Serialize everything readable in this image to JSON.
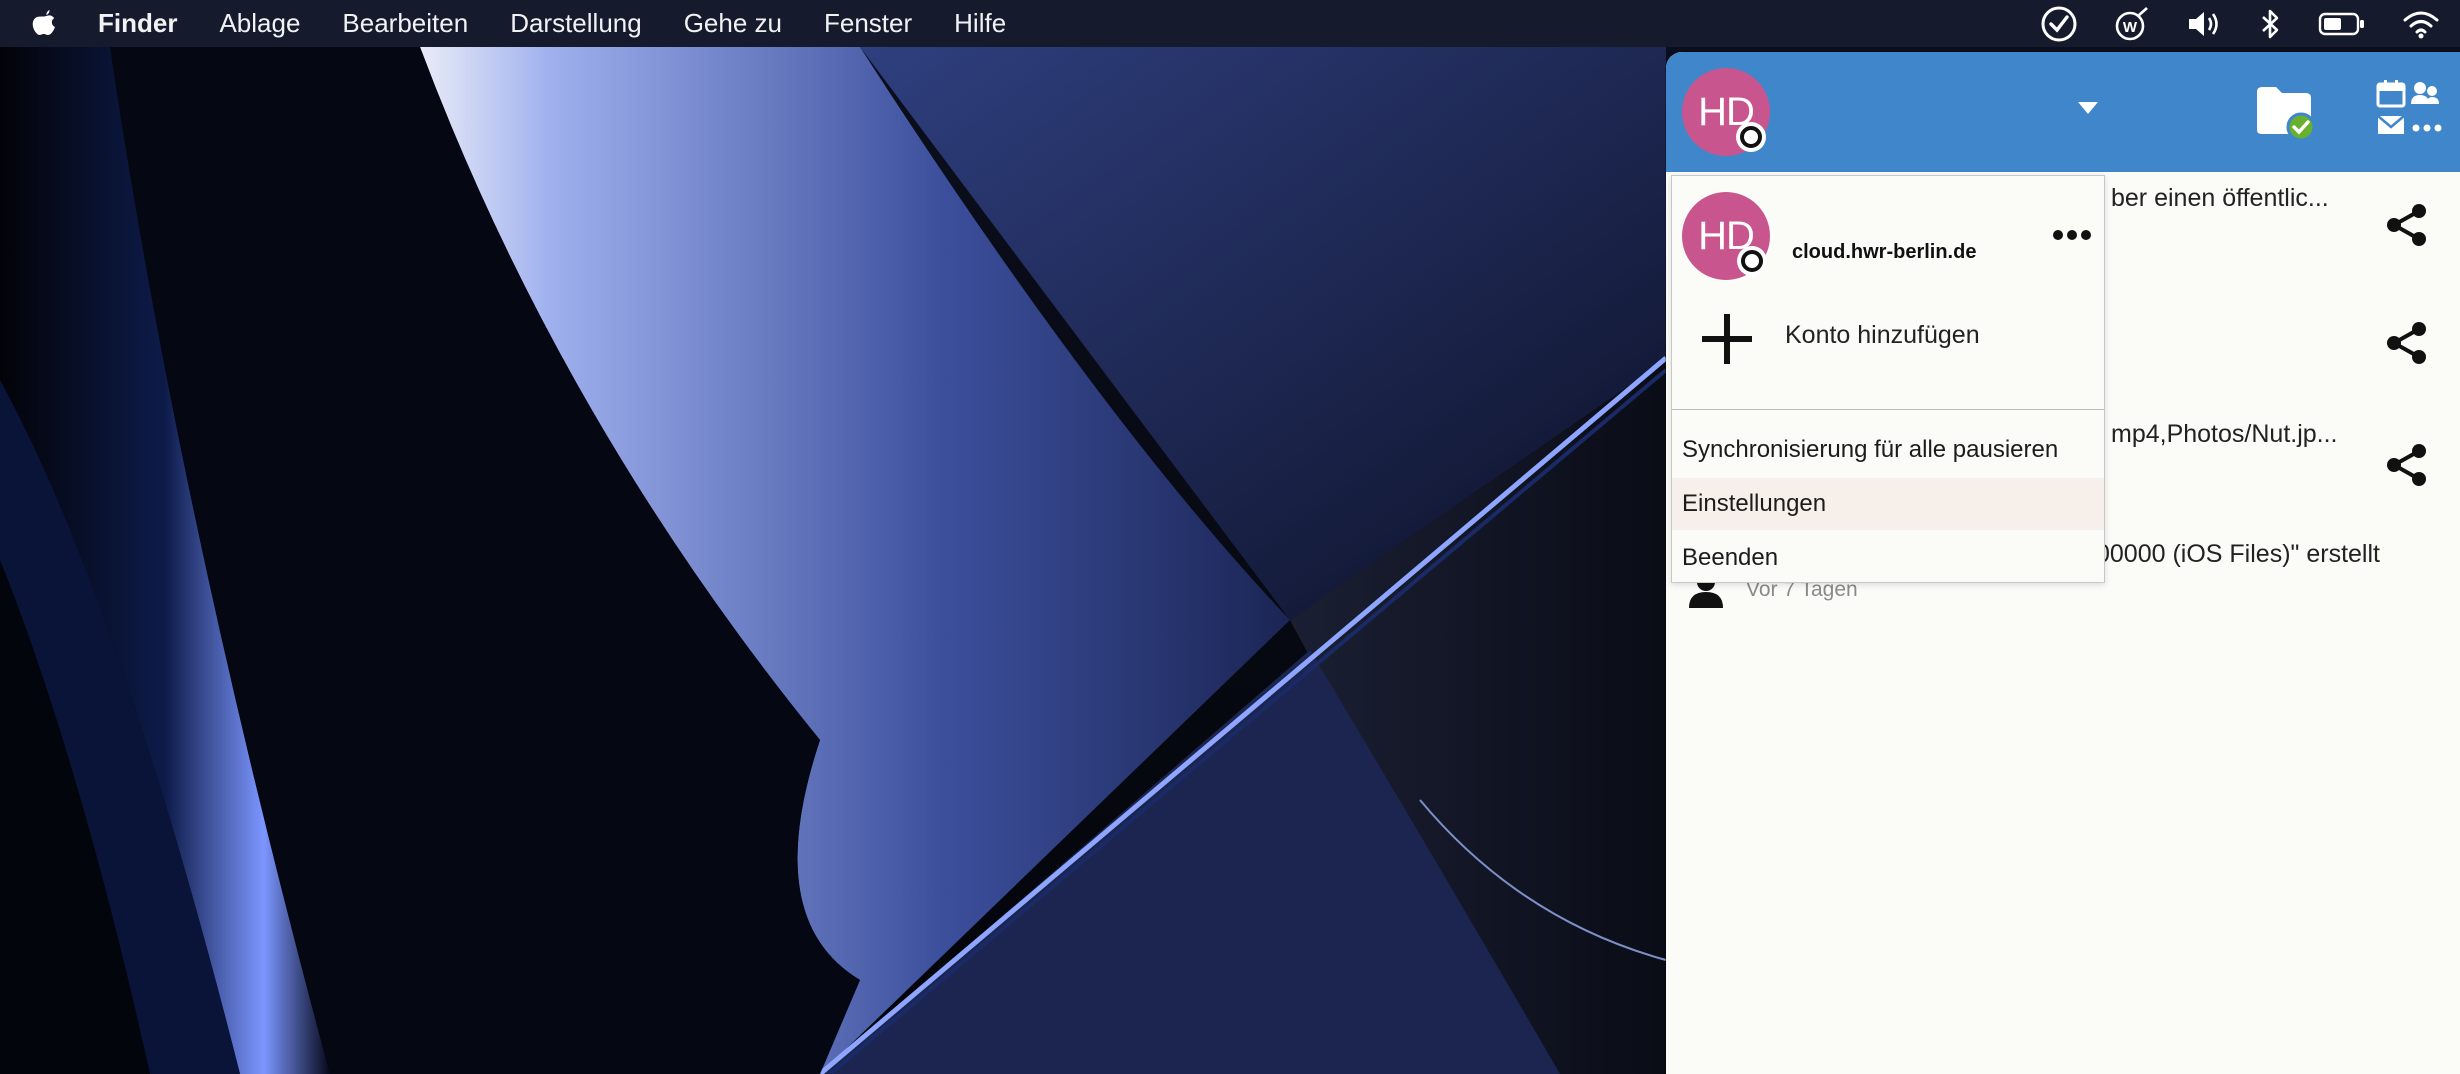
{
  "menubar": {
    "app_name": "Finder",
    "items": [
      "Ablage",
      "Bearbeiten",
      "Darstellung",
      "Gehe zu",
      "Fenster",
      "Hilfe"
    ],
    "status_icons": [
      "checkmark-circle-icon",
      "word-icon",
      "volume-icon",
      "bluetooth-icon",
      "battery-icon",
      "wifi-icon"
    ]
  },
  "nextcloud": {
    "header": {
      "avatar_initials": "HD",
      "status": "offline"
    },
    "activities": [
      {
        "text": "ber einen öffentlic...",
        "time": ""
      },
      {
        "text": "",
        "time": ""
      },
      {
        "text": "mp4,Photos/Nut.jp...",
        "time": ""
      },
      {
        "text": "00000 (iOS Files)\" erstellt",
        "time": "Vor 7 Tagen"
      }
    ],
    "account_menu": {
      "account": {
        "avatar_initials": "HD",
        "server": "cloud.hwr-berlin.de"
      },
      "add_account_label": "Konto hinzufügen",
      "entries": [
        "Synchronisierung für alle pausieren",
        "Einstellungen",
        "Beenden"
      ],
      "hovered_entry": "Einstellungen"
    },
    "colors": {
      "header": "#3f86cb",
      "avatar": "#c9558e",
      "sync_ok": "#6ab02f"
    }
  }
}
